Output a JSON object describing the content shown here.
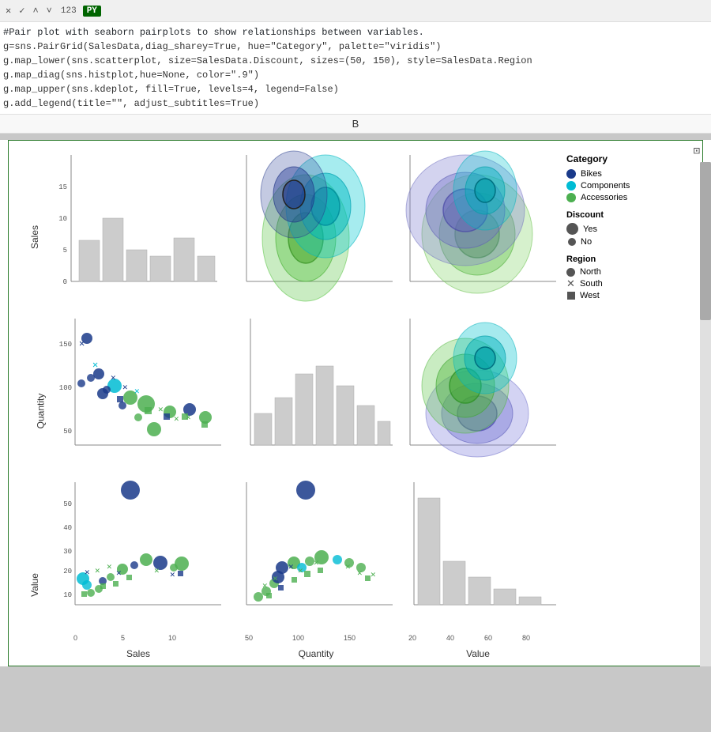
{
  "toolbar": {
    "cancel_btn": "✕",
    "check_btn": "✓",
    "chevron_up": "˄",
    "chevron_down": "˅",
    "run_counter": "123",
    "py_badge": "PY",
    "expand_icon": "⊡"
  },
  "code": {
    "comment": "#Pair plot with seaborn pairplots to show relationships between variables.",
    "line1": "g=sns.PairGrid(SalesData,diag_sharey=True, hue=\"Category\", palette=\"viridis\")",
    "line2": "g.map_lower(sns.scatterplot, size=SalesData.Discount, sizes=(50, 150), style=SalesData.Region",
    "line3": "g.map_diag(sns.histplot,hue=None, color=\".9\")",
    "line4": "g.map_upper(sns.kdeplot, fill=True, levels=4, legend=False)",
    "line5": "g.add_legend(title=\"\", adjust_subtitles=True)"
  },
  "output_bar": {
    "label": "B"
  },
  "legend": {
    "category_title": "Category",
    "items": [
      {
        "label": "Bikes",
        "color": "#1a3a8a"
      },
      {
        "label": "Components",
        "color": "#00bcd4"
      },
      {
        "label": "Accessories",
        "color": "#4caf50"
      }
    ],
    "discount_title": "Discount",
    "discount_items": [
      {
        "label": "Yes",
        "size": "large"
      },
      {
        "label": "No",
        "size": "small"
      }
    ],
    "region_title": "Region",
    "region_items": [
      {
        "label": "North",
        "marker": "circle"
      },
      {
        "label": "South",
        "marker": "x"
      },
      {
        "label": "West",
        "marker": "square"
      }
    ]
  },
  "axes": {
    "row_labels": [
      "Sales",
      "Quantity",
      "Value"
    ],
    "col_labels": [
      "Sales",
      "Quantity",
      "Value"
    ],
    "sales_yticks": [
      "0",
      "5",
      "10",
      "15"
    ],
    "quantity_yticks": [
      "50",
      "100",
      "150"
    ],
    "value_yticks": [
      "20",
      "30",
      "40",
      "50"
    ],
    "sales_xticks": [
      "0",
      "5",
      "10"
    ],
    "quantity_xticks": [
      "50",
      "100",
      "150"
    ],
    "value_xticks": [
      "20",
      "40",
      "60",
      "80"
    ]
  }
}
